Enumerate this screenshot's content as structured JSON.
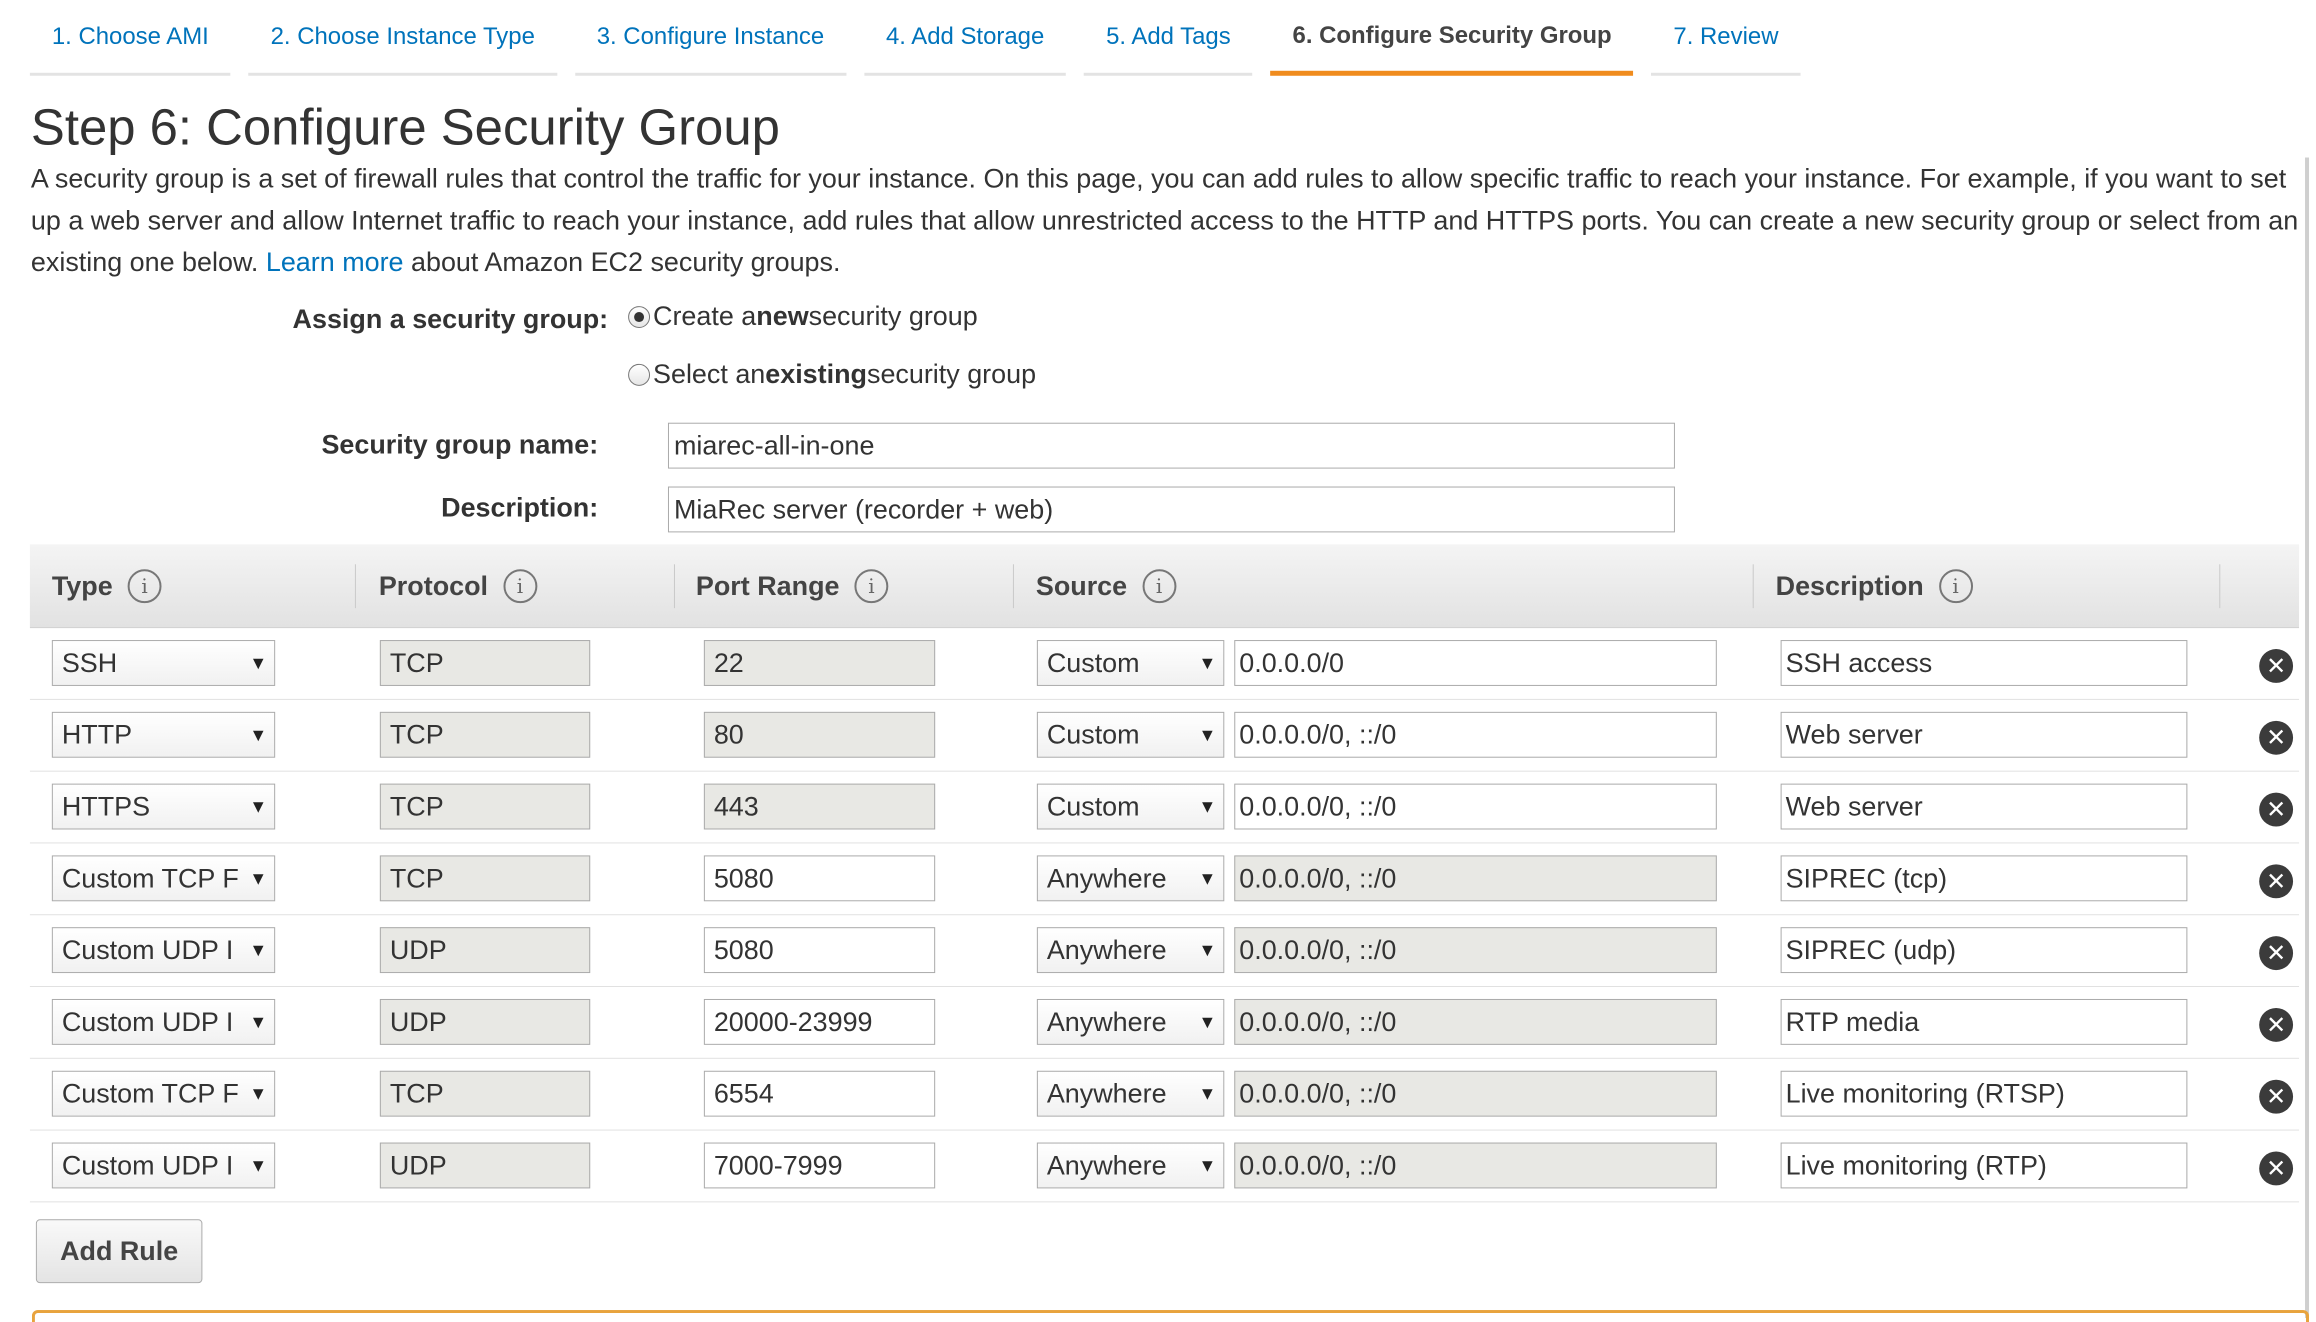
{
  "tabs": [
    {
      "label": "1. Choose AMI"
    },
    {
      "label": "2. Choose Instance Type"
    },
    {
      "label": "3. Configure Instance"
    },
    {
      "label": "4. Add Storage"
    },
    {
      "label": "5. Add Tags"
    },
    {
      "label": "6. Configure Security Group",
      "active": true
    },
    {
      "label": "7. Review"
    }
  ],
  "page": {
    "title": "Step 6: Configure Security Group",
    "intro": "A security group is a set of firewall rules that control the traffic for your instance. On this page, you can add rules to allow specific traffic to reach your instance. For example, if you want to set up a web server and allow Internet traffic to reach your instance, add rules that allow unrestricted access to the HTTP and HTTPS ports. You can create a new security group or select from an existing one below.",
    "learn_more": "Learn more",
    "intro_tail": "about Amazon EC2 security groups."
  },
  "assign": {
    "label": "Assign a security group:",
    "create_pre": "Create a ",
    "create_bold": "new",
    "create_post": " security group",
    "select_pre": "Select an ",
    "select_bold": "existing",
    "select_post": " security group",
    "selected": "create"
  },
  "form": {
    "name_label": "Security group name:",
    "name_value": "miarec-all-in-one",
    "desc_label": "Description:",
    "desc_value": "MiaRec server (recorder + web)"
  },
  "table": {
    "headers": {
      "type": "Type",
      "protocol": "Protocol",
      "port_range": "Port Range",
      "source": "Source",
      "description": "Description"
    },
    "info_glyph": "i",
    "remove_glyph": "✕",
    "select_arrow": "▼",
    "rules": [
      {
        "type": "SSH",
        "protocol": "TCP",
        "port": "22",
        "port_editable": false,
        "source_type": "Custom",
        "source": "0.0.0.0/0",
        "source_editable": true,
        "description": "SSH access"
      },
      {
        "type": "HTTP",
        "protocol": "TCP",
        "port": "80",
        "port_editable": false,
        "source_type": "Custom",
        "source": "0.0.0.0/0, ::/0",
        "source_editable": true,
        "description": "Web server"
      },
      {
        "type": "HTTPS",
        "protocol": "TCP",
        "port": "443",
        "port_editable": false,
        "source_type": "Custom",
        "source": "0.0.0.0/0, ::/0",
        "source_editable": true,
        "description": "Web server"
      },
      {
        "type": "Custom TCP F",
        "protocol": "TCP",
        "port": "5080",
        "port_editable": true,
        "source_type": "Anywhere",
        "source": "0.0.0.0/0, ::/0",
        "source_editable": false,
        "description": "SIPREC (tcp)"
      },
      {
        "type": "Custom UDP I",
        "protocol": "UDP",
        "port": "5080",
        "port_editable": true,
        "source_type": "Anywhere",
        "source": "0.0.0.0/0, ::/0",
        "source_editable": false,
        "description": "SIPREC (udp)"
      },
      {
        "type": "Custom UDP I",
        "protocol": "UDP",
        "port": "20000-23999",
        "port_editable": true,
        "source_type": "Anywhere",
        "source": "0.0.0.0/0, ::/0",
        "source_editable": false,
        "description": "RTP media"
      },
      {
        "type": "Custom TCP F",
        "protocol": "TCP",
        "port": "6554",
        "port_editable": true,
        "source_type": "Anywhere",
        "source": "0.0.0.0/0, ::/0",
        "source_editable": false,
        "description": "Live monitoring (RTSP)"
      },
      {
        "type": "Custom UDP I",
        "protocol": "UDP",
        "port": "7000-7999",
        "port_editable": true,
        "source_type": "Anywhere",
        "source": "0.0.0.0/0, ::/0",
        "source_editable": false,
        "description": "Live monitoring (RTP)"
      }
    ]
  },
  "actions": {
    "add_rule": "Add Rule"
  },
  "colors": {
    "link": "#0073bb",
    "active_tab": "#f08c1e",
    "readonly_bg": "#e8e8e4"
  }
}
